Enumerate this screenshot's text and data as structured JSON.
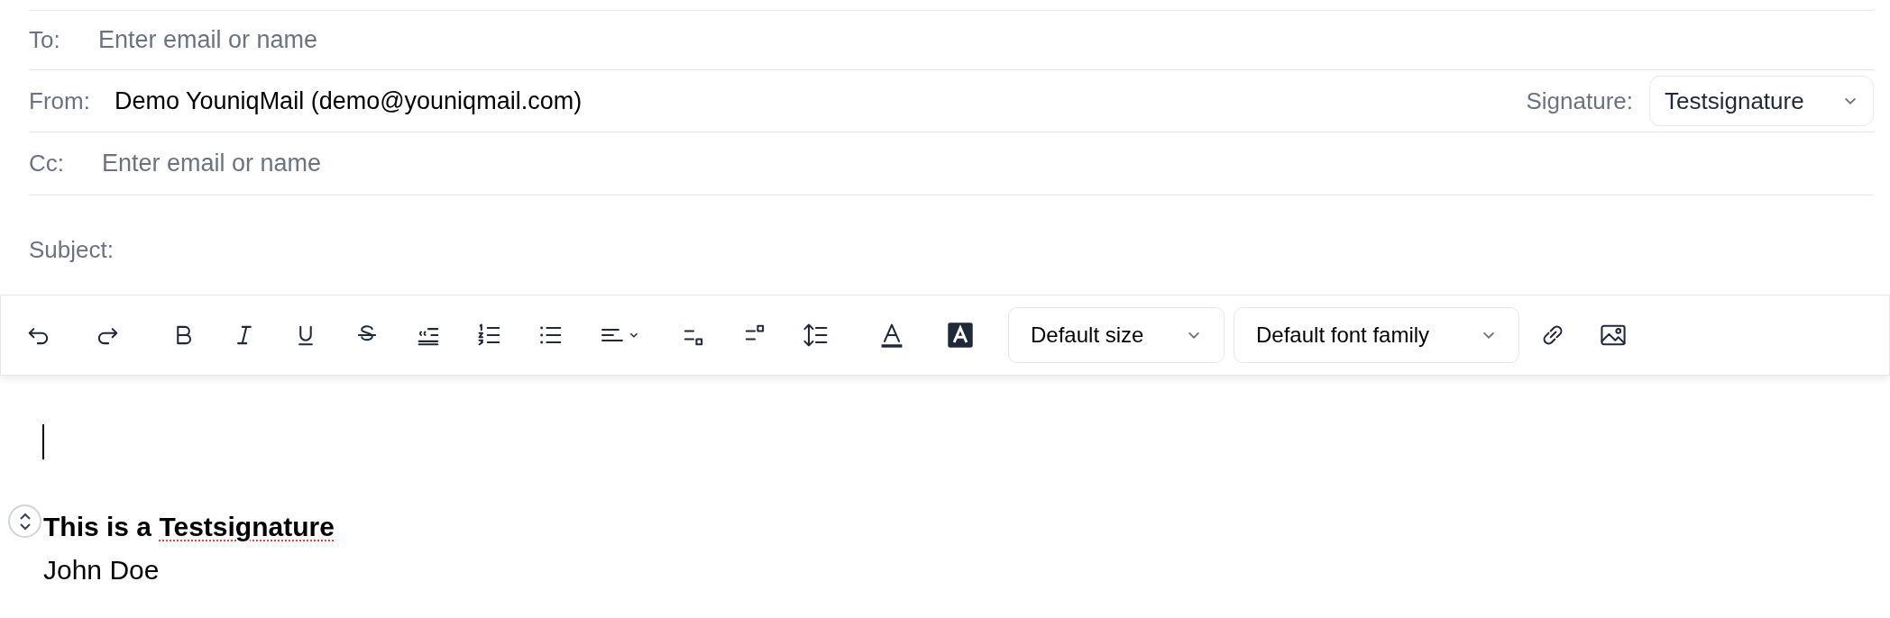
{
  "header": {
    "to": {
      "label": "To:",
      "placeholder": "Enter email or name"
    },
    "from": {
      "label": "From:",
      "value": "Demo YouniqMail (demo@youniqmail.com)"
    },
    "signature": {
      "label": "Signature:",
      "value": "Testsignature"
    },
    "cc": {
      "label": "Cc:",
      "placeholder": "Enter email or name"
    },
    "subject": {
      "label": "Subject:"
    }
  },
  "toolbar": [
    {
      "kind": "undo"
    },
    {
      "kind": "redo"
    },
    {
      "kind": "bold"
    },
    {
      "kind": "italic"
    },
    {
      "kind": "underline"
    },
    {
      "kind": "strikethrough"
    },
    {
      "kind": "blockquote"
    },
    {
      "kind": "ordered-list"
    },
    {
      "kind": "bullet-list"
    },
    {
      "kind": "align"
    },
    {
      "kind": "subscript"
    },
    {
      "kind": "superscript"
    },
    {
      "kind": "line-height"
    },
    {
      "kind": "text-color"
    },
    {
      "kind": "highlight"
    },
    {
      "kind": "dropdown",
      "label": "Default size"
    },
    {
      "kind": "dropdown",
      "label": "Default font family"
    },
    {
      "kind": "link"
    },
    {
      "kind": "image"
    }
  ],
  "body": {
    "signature_lines": [
      {
        "bold": true,
        "segments": [
          {
            "text": "This is a ",
            "misspelled": false
          },
          {
            "text": "Testsignature",
            "misspelled": true
          }
        ]
      },
      {
        "bold": false,
        "segments": [
          {
            "text": "John Doe",
            "misspelled": false
          }
        ]
      }
    ]
  }
}
